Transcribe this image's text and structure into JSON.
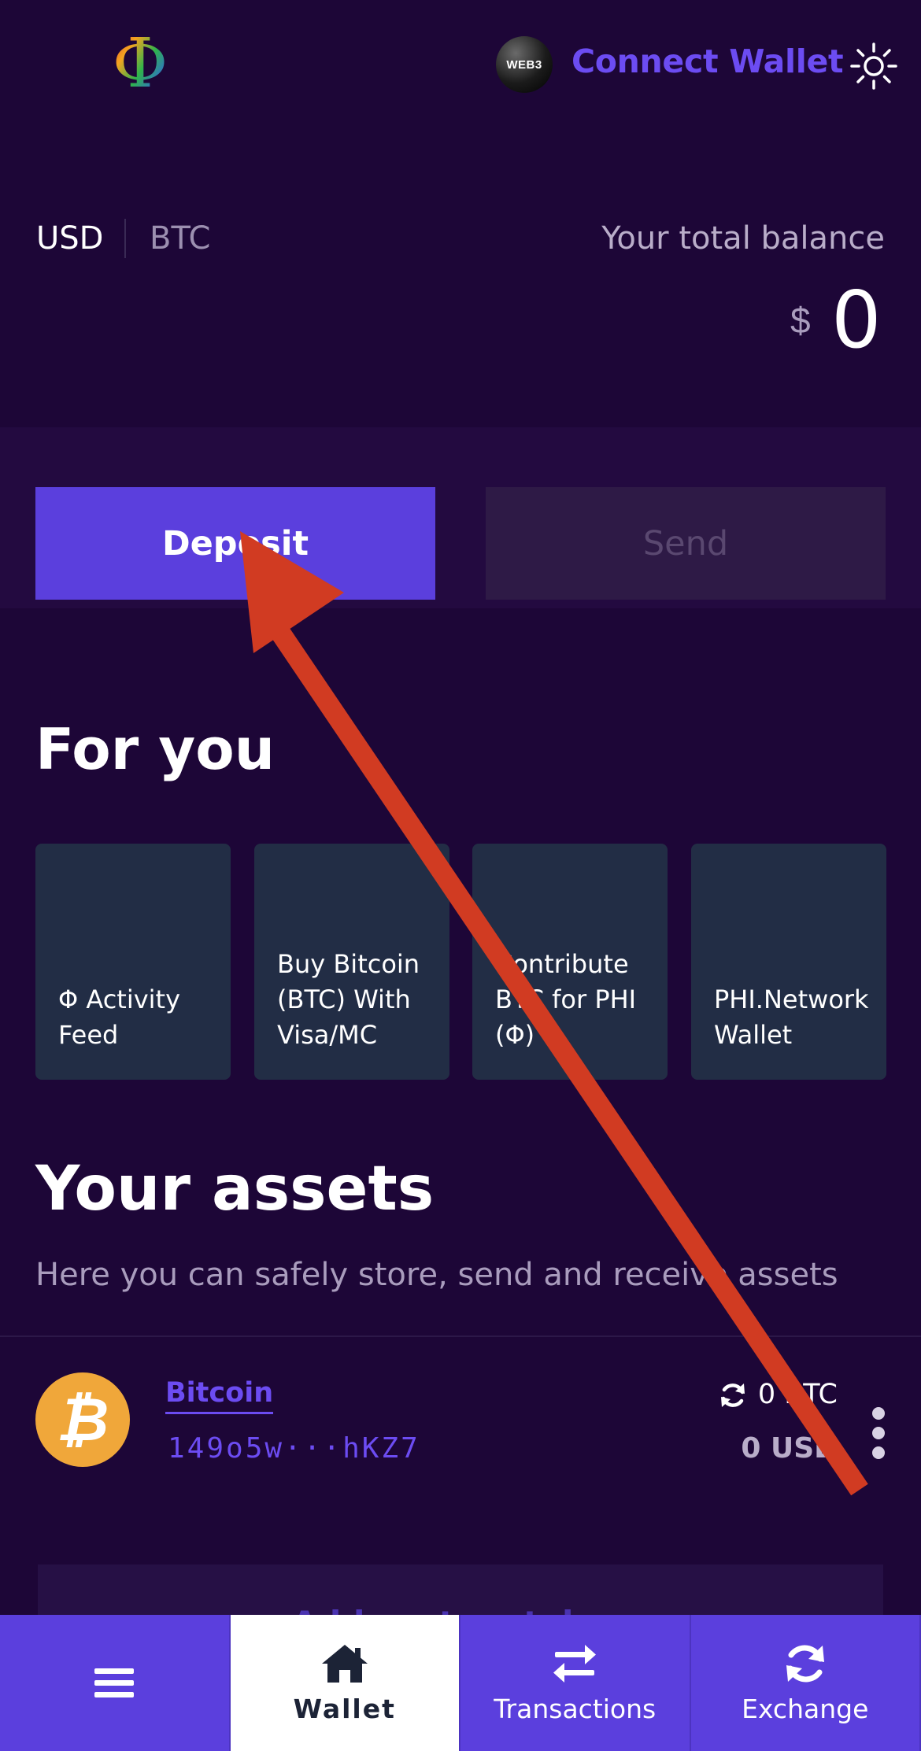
{
  "header": {
    "logo_glyph": "Φ",
    "web3_badge": "WEB3",
    "connect_label": "Connect Wallet"
  },
  "balance": {
    "currency_usd": "USD",
    "currency_btc": "BTC",
    "selected_currency": "USD",
    "label": "Your total balance",
    "symbol": "$",
    "value": "0"
  },
  "actions": {
    "deposit_label": "Deposit",
    "send_label": "Send"
  },
  "for_you": {
    "title": "For you",
    "cards": [
      {
        "label": "Φ Activity Feed"
      },
      {
        "label": "Buy Bitcoin (BTC) With Visa/MC"
      },
      {
        "label": "Contribute BTC for PHI (Φ)"
      },
      {
        "label": "PHI.Network Wallet"
      }
    ]
  },
  "assets": {
    "title": "Your assets",
    "subtitle": "Here you can safely store, send and receive assets",
    "items": [
      {
        "name": "Bitcoin",
        "address": "149o5w···hKZ7",
        "amount": "0 BTC",
        "usd": "0 USD",
        "icon": "bitcoin-icon",
        "icon_glyph": "₿",
        "icon_color": "#f0a73a"
      }
    ],
    "add_token_label": "Add custom token"
  },
  "bottom_nav": {
    "items": [
      {
        "label": "",
        "icon": "menu-icon"
      },
      {
        "label": "Wallet",
        "icon": "home-icon",
        "active": true
      },
      {
        "label": "Transactions",
        "icon": "swap-arrows-icon"
      },
      {
        "label": "Exchange",
        "icon": "refresh-icon"
      }
    ]
  },
  "colors": {
    "background": "#1d0637",
    "accent": "#5b3fdd",
    "link": "#6c4cf2",
    "card": "#222d45",
    "annotation_arrow": "#d13b22"
  }
}
